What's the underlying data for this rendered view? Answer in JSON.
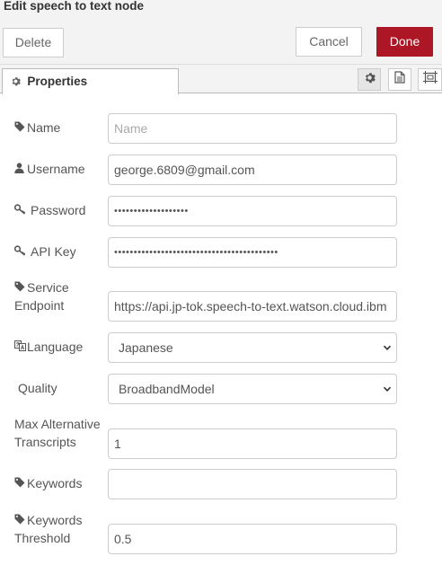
{
  "dialog": {
    "title": "Edit speech to text node"
  },
  "buttons": {
    "delete": "Delete",
    "cancel": "Cancel",
    "done": "Done"
  },
  "tabs": {
    "properties": "Properties"
  },
  "form": {
    "name": {
      "label": "Name",
      "value": "",
      "placeholder": "Name"
    },
    "username": {
      "label": "Username",
      "value": "george.6809@gmail.com"
    },
    "password": {
      "label": "Password",
      "value": "•••••••••••••••••••"
    },
    "apikey": {
      "label": "API Key",
      "value": "••••••••••••••••••••••••••••••••••••••••••"
    },
    "endpoint": {
      "label_line1": "Service",
      "label_line2": "Endpoint",
      "value": "https://api.jp-tok.speech-to-text.watson.cloud.ibm"
    },
    "language": {
      "label": "Language",
      "value": "Japanese"
    },
    "quality": {
      "label": "Quality",
      "value": "BroadbandModel"
    },
    "max_alt": {
      "label_line1": "Max Alternative",
      "label_line2": "Transcripts",
      "value": "1"
    },
    "keywords": {
      "label": "Keywords",
      "value": ""
    },
    "keywords_threshold": {
      "label_line1": "Keywords",
      "label_line2": "Threshold",
      "value": "0.5"
    }
  },
  "colors": {
    "done_button": "#ad1625",
    "panel_bg": "#f3f3f3"
  },
  "icons": {
    "tab_gear": "gear-icon",
    "tab_doc": "document-icon",
    "tab_frame": "frame-icon",
    "tag": "tag-icon",
    "user": "user-icon",
    "key": "key-icon",
    "language": "language-icon"
  }
}
